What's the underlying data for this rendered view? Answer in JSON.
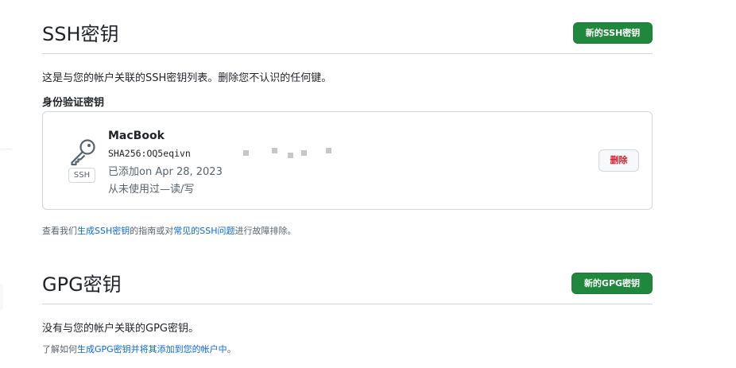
{
  "ssh": {
    "title": "SSH密钥",
    "new_button": "新的SSH密钥",
    "description": "这是与您的帐户关联的SSH密钥列表。删除您不认识的任何键。",
    "auth_heading": "身份验证密钥",
    "keys": [
      {
        "name": "MacBook",
        "type_badge": "SSH",
        "fingerprint": "SHA256:OQ5eqivn",
        "fingerprint_tail": "                                                    ",
        "added": "已添加on Apr 28, 2023",
        "usage": "从未使用过—读/写",
        "delete_label": "删除",
        "icon": "key-icon"
      }
    ],
    "help": {
      "prefix": "查看我们",
      "link1": "生成SSH密钥",
      "middle": "的指南或对",
      "link2": "常见的SSH问题",
      "suffix": "进行故障排除。"
    }
  },
  "gpg": {
    "title": "GPG密钥",
    "new_button": "新的GPG密钥",
    "description": "没有与您的帐户关联的GPG密钥。",
    "help": {
      "prefix": "了解如何",
      "link1": "生成GPG密钥并将其添加到您的帐户中",
      "suffix": "。"
    }
  },
  "colors": {
    "primary_button": "#1f883d",
    "danger_text": "#d1242f",
    "link": "#0969da",
    "border": "#d0d7de",
    "muted_text": "#59636e"
  }
}
